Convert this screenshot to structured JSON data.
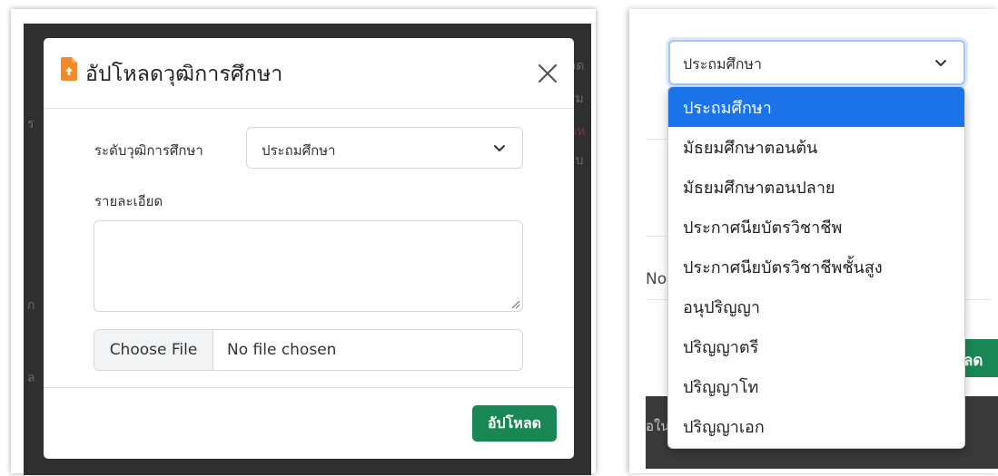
{
  "upload_modal": {
    "title": "อัปโหลดวุฒิการศึกษา",
    "level_label": "ระดับวุฒิการศึกษา",
    "level_selected": "ประถมศึกษา",
    "detail_label": "รายละเอียด",
    "detail_value": "",
    "choose_file_label": "Choose File",
    "file_status": "No file chosen",
    "upload_label": "อัปโหลด"
  },
  "dropdown_view": {
    "selected": "ประถมศึกษา",
    "options": [
      "ประถมศึกษา",
      "มัธยมศึกษาตอนต้น",
      "มัธยมศึกษาตอนปลาย",
      "ประกาศนียบัตรวิชาชีพ",
      "ประกาศนียบัตรวิชาชีพชั้นสูง",
      "อนุปริญญา",
      "ปริญญาตรี",
      "ปริญญาโท",
      "ปริญญาเอก"
    ],
    "background_fragments": {
      "no_text": "No",
      "green_button_fragment": "ลด",
      "dark_bar_fragment": "อใน"
    }
  },
  "colors": {
    "primary_green": "#198754",
    "selected_blue": "#1a73e8",
    "backdrop": "#2f2f2f",
    "file_icon_orange": "#f08a24"
  },
  "icons": {
    "title_icon": "file-upload-icon",
    "close": "close-icon",
    "select_arrow": "chevron-down-icon"
  }
}
